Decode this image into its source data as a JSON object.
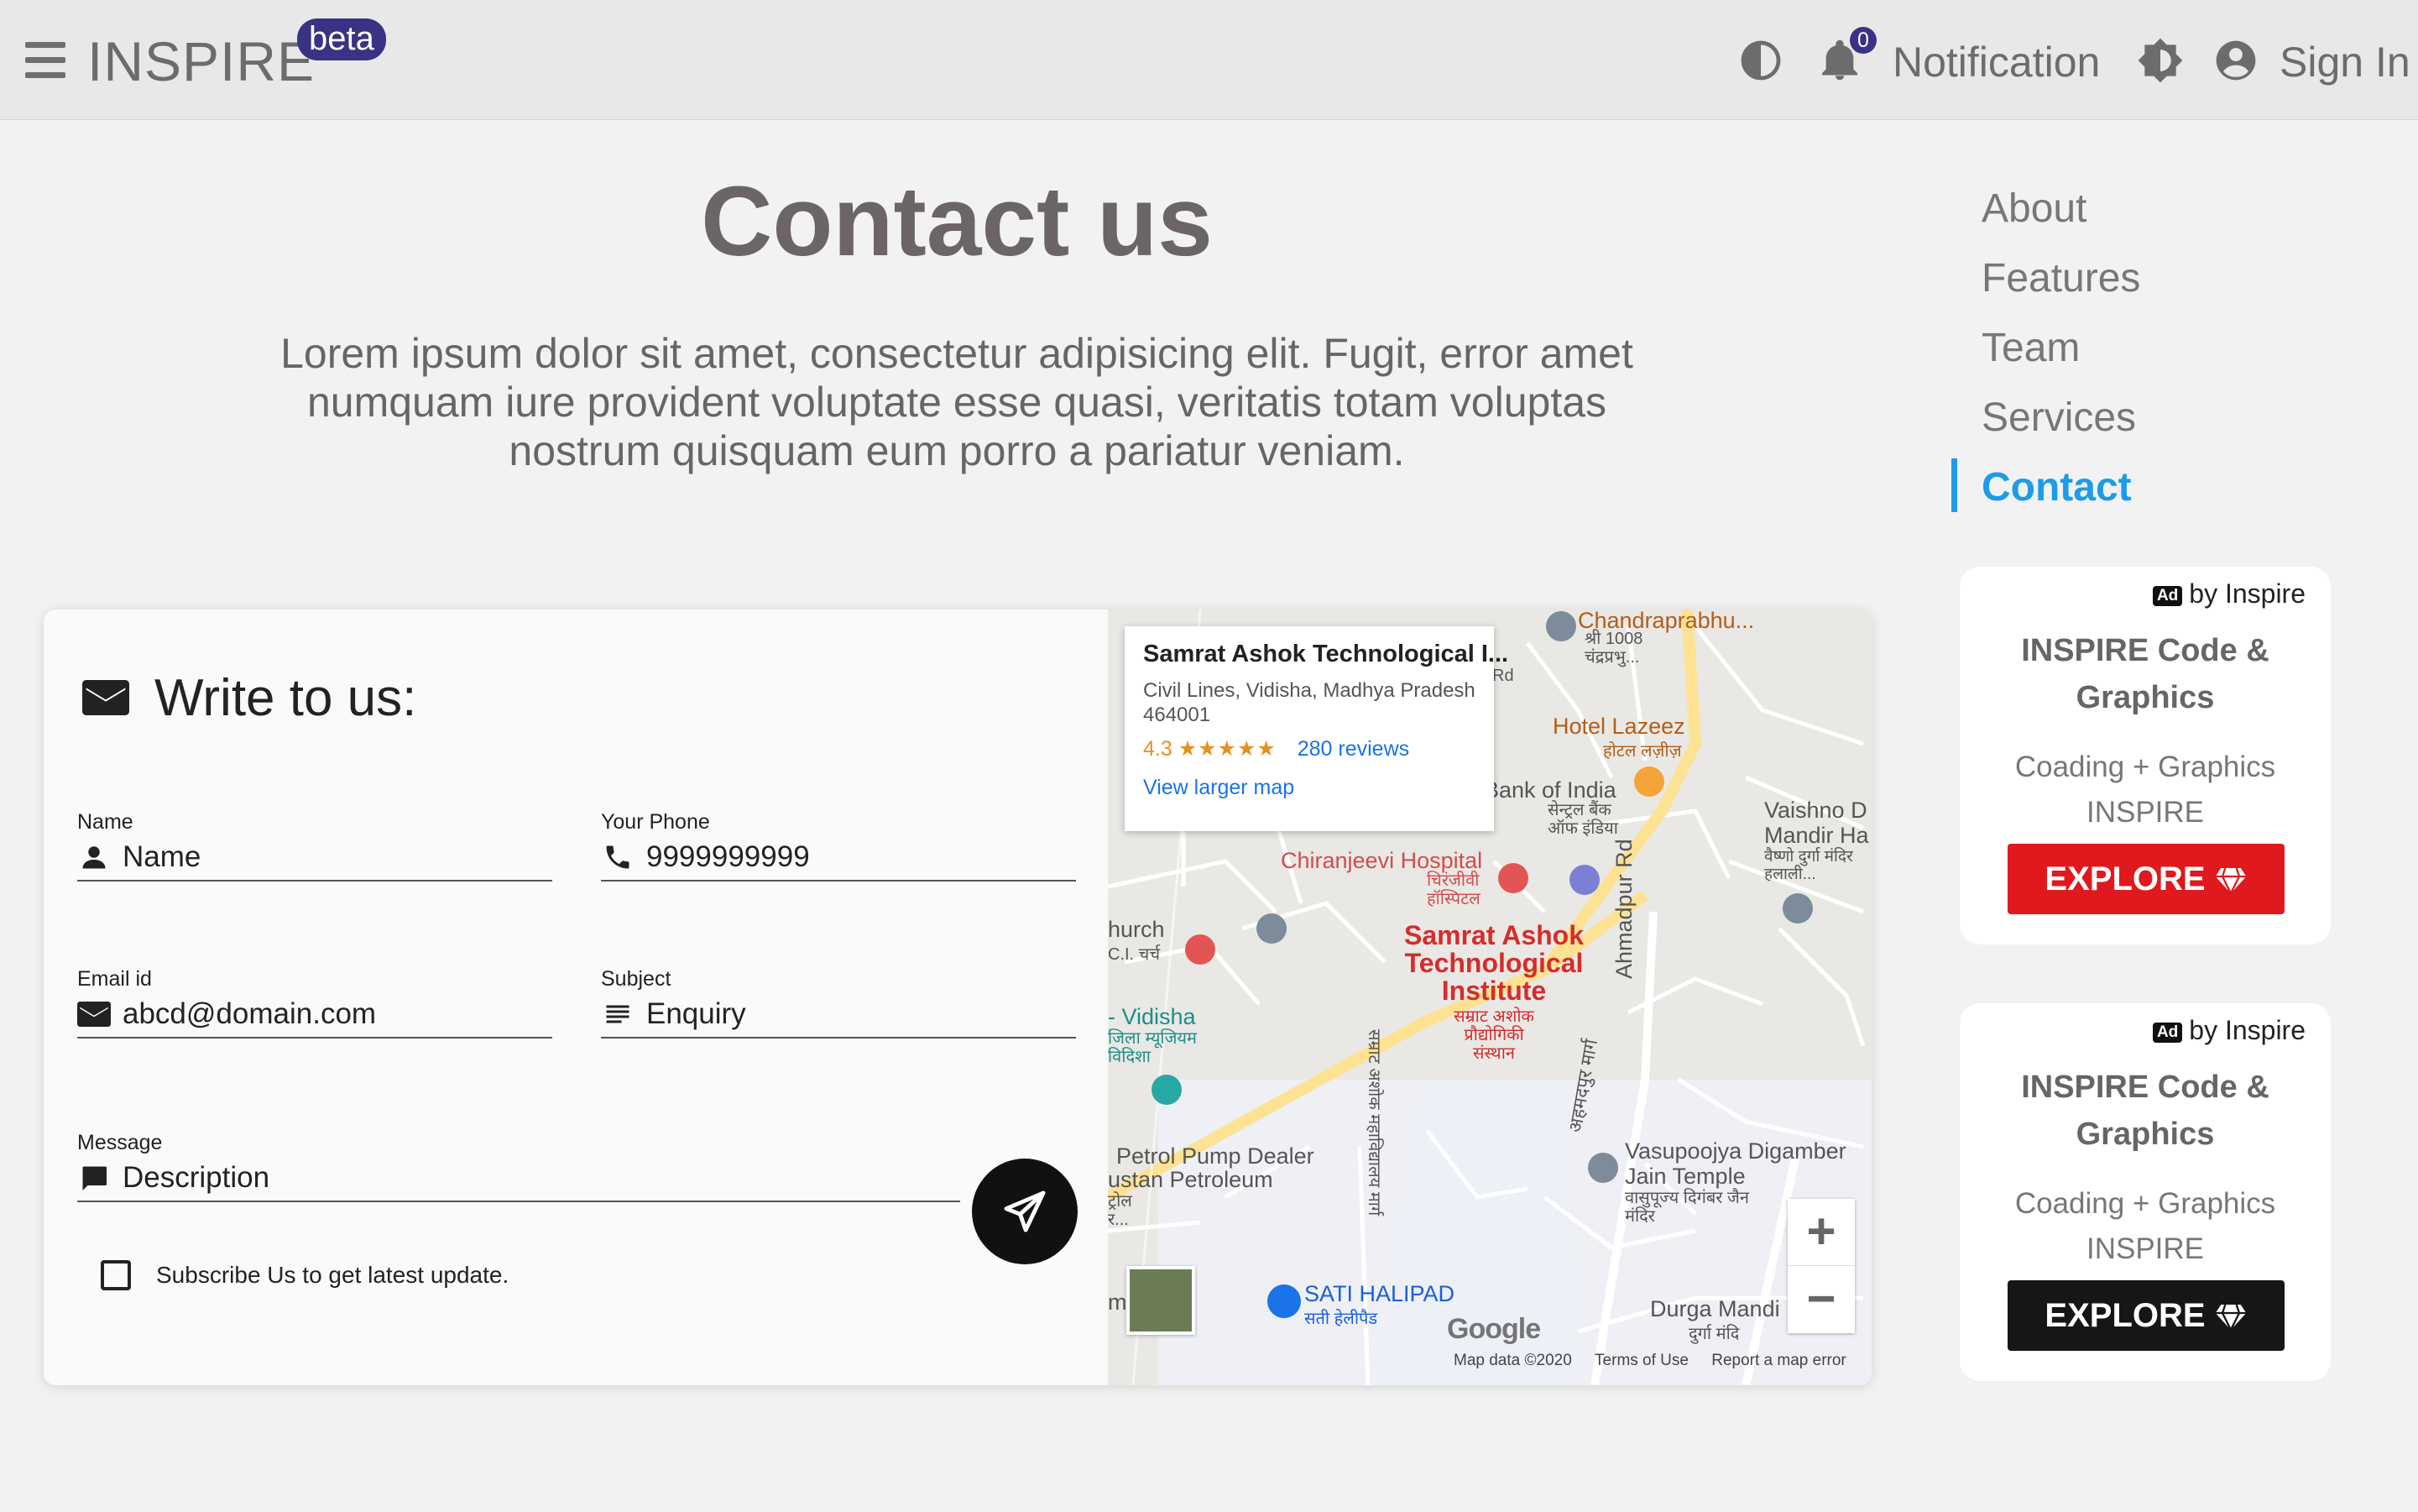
{
  "header": {
    "brand": "INSPIRE",
    "beta": "beta",
    "notification_count": "0",
    "notification_label": "Notification",
    "signin_label": "Sign In"
  },
  "page": {
    "title": "Contact us",
    "lead": "Lorem ipsum dolor sit amet, consectetur adipisicing elit. Fugit, error amet numquam iure provident voluptate esse quasi, veritatis totam voluptas nostrum quisquam eum porro a pariatur veniam."
  },
  "toc": [
    {
      "label": "About"
    },
    {
      "label": "Features"
    },
    {
      "label": "Team"
    },
    {
      "label": "Services"
    },
    {
      "label": "Contact",
      "active": true
    }
  ],
  "form": {
    "heading": "Write to us:",
    "name": {
      "label": "Name",
      "value": "Name"
    },
    "phone": {
      "label": "Your Phone",
      "value": "9999999999"
    },
    "email": {
      "label": "Email id",
      "value": "abcd@domain.com"
    },
    "subject": {
      "label": "Subject",
      "value": "Enquiry"
    },
    "message": {
      "label": "Message",
      "value": "Description"
    },
    "subscribe_label": "Subscribe Us to get latest update."
  },
  "map": {
    "place_title": "Samrat Ashok Technological I...",
    "address": "Civil Lines, Vidisha, Madhya Pradesh 464001",
    "rating": "4.3",
    "stars": "★★★★★",
    "reviews": "280 reviews",
    "larger_map": "View larger map",
    "labels": {
      "chandraprabhu": "Chandraprabhu...",
      "chandraprabhu_sub": "श्री 1008 चंद्रप्रभु...",
      "hotel": "Hotel Lazeez",
      "hotel_sub": "होटल लज़ीज़",
      "bank": "Bank of India",
      "bank_sub": "सेन्ट्रल बैंक ऑफ इंडिया",
      "vaishno": "Vaishno D Mandir Ha",
      "vaishno_sub": "वैष्णो दुर्गा मंदिर हलाली...",
      "chiranjeevi": "Chiranjeevi Hospital",
      "chiranjeevi_sub": "चिरंजीवी हॉस्पिटल",
      "church": "hurch",
      "church_sub": "C.I. चर्च",
      "samrat": "Samrat Ashok Technological Institute",
      "samrat_sub": "सम्राट अशोक प्रौद्योगिकी संस्थान",
      "ahmadpur": "Ahmadpur Rd",
      "ahmadpur_hi": "अहमदपुर मार्ग",
      "vidisha": "- Vidisha",
      "vidisha_sub": "जिला म्यूजियम विदिशा",
      "petrol": "Petrol Pump Dealer",
      "petrol2": "ustan Petroleum",
      "petrol_sub": "ट्रोल र...",
      "vasupoojya": "Vasupoojya Digamber Jain Temple",
      "vasupoojya_sub": "वासुपूज्य दिगंबर जैन मंदिर",
      "sati": "SATI HALIPAD",
      "sati_sub": "सती हेलीपैड",
      "durga": "Durga Mandi",
      "durga_sub": "दुर्गा मंदि",
      "road_hi": "सम्राट अशोक महाविद्यालय मार्ग",
      "rd": "Rd",
      "m_edge": "m"
    },
    "zoom_in": "+",
    "zoom_out": "−",
    "google": "Google",
    "footer": [
      "Map data ©2020",
      "Terms of Use",
      "Report a map error"
    ]
  },
  "ads": [
    {
      "tag": "Ad",
      "by": "by Inspire",
      "title": "INSPIRE Code & Graphics",
      "sub": "Coading + Graphics INSPIRE",
      "cta": "EXPLORE",
      "color": "#e0191e"
    },
    {
      "tag": "Ad",
      "by": "by Inspire",
      "title": "INSPIRE Code & Graphics",
      "sub": "Coading + Graphics INSPIRE",
      "cta": "EXPLORE",
      "color": "#161616"
    }
  ],
  "colors": {
    "accent": "#1e9be8",
    "brand_badge": "#3a3284"
  }
}
